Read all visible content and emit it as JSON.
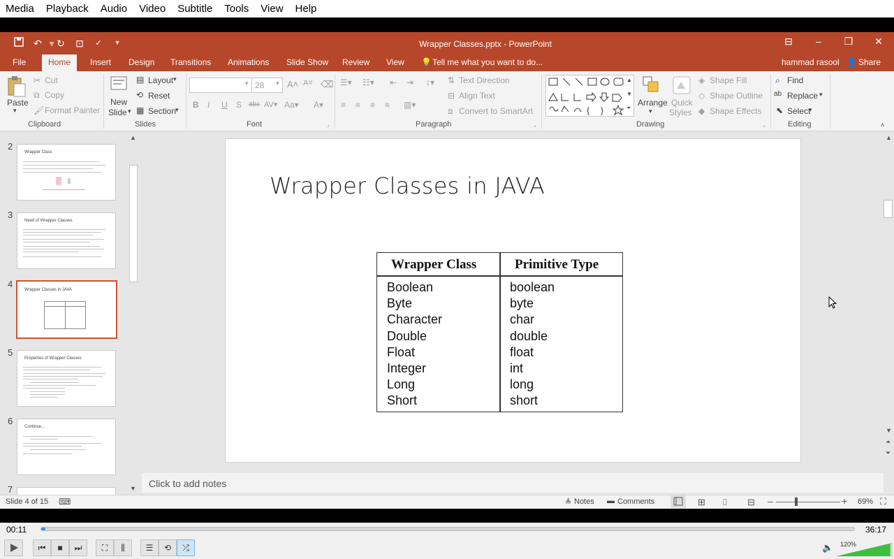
{
  "vlc": {
    "menu": [
      "Media",
      "Playback",
      "Audio",
      "Video",
      "Subtitle",
      "Tools",
      "View",
      "Help"
    ],
    "time_elapsed": "00:11",
    "time_total": "36:17",
    "progress": 0.005,
    "volume_label": "120%",
    "volume": 1.2
  },
  "ppt": {
    "window_title": "Wrapper Classes.pptx - PowerPoint",
    "tabs": [
      "File",
      "Home",
      "Insert",
      "Design",
      "Transitions",
      "Animations",
      "Slide Show",
      "Review",
      "View"
    ],
    "active_tab": "Home",
    "tell_me": "Tell me what you want to do...",
    "user": "hammad rasool",
    "share": "Share",
    "clipboard": {
      "paste": "Paste",
      "cut": "Cut",
      "copy": "Copy",
      "format_painter": "Format Painter",
      "group": "Clipboard"
    },
    "slides": {
      "new_slide_1": "New",
      "new_slide_2": "Slide",
      "layout": "Layout",
      "reset": "Reset",
      "section": "Section",
      "group": "Slides"
    },
    "font": {
      "size": "28",
      "group": "Font"
    },
    "paragraph": {
      "text_direction": "Text Direction",
      "align_text": "Align Text",
      "convert_smartart": "Convert to SmartArt",
      "group": "Paragraph"
    },
    "drawing": {
      "arrange": "Arrange",
      "quick_styles_1": "Quick",
      "quick_styles_2": "Styles",
      "shape_fill": "Shape Fill",
      "shape_outline": "Shape Outline",
      "shape_effects": "Shape Effects",
      "group": "Drawing"
    },
    "editing": {
      "find": "Find",
      "replace": "Replace",
      "select": "Select",
      "group": "Editing"
    },
    "thumbnails": [
      {
        "num": "2",
        "title": "Wrapper Class"
      },
      {
        "num": "3",
        "title": "Need of Wrapper Classes"
      },
      {
        "num": "4",
        "title": "Wrapper Classes in JAVA"
      },
      {
        "num": "5",
        "title": "Properties of Wrapper Classes"
      },
      {
        "num": "6",
        "title": "Continue..."
      },
      {
        "num": "7",
        "title": ""
      }
    ],
    "slide": {
      "title": "Wrapper Classes in JAVA",
      "table_headers": [
        "Wrapper Class",
        "Primitive Type"
      ],
      "wrapper": [
        "Boolean",
        "Byte",
        "Character",
        "Double",
        "Float",
        "Integer",
        "Long",
        "Short"
      ],
      "primitive": [
        "boolean",
        "byte",
        "char",
        "double",
        "float",
        "int",
        "long",
        "short"
      ]
    },
    "notes_placeholder": "Click to add notes",
    "status": {
      "slide_info": "Slide 4 of 15",
      "notes": "Notes",
      "comments": "Comments",
      "zoom": "69%"
    }
  }
}
